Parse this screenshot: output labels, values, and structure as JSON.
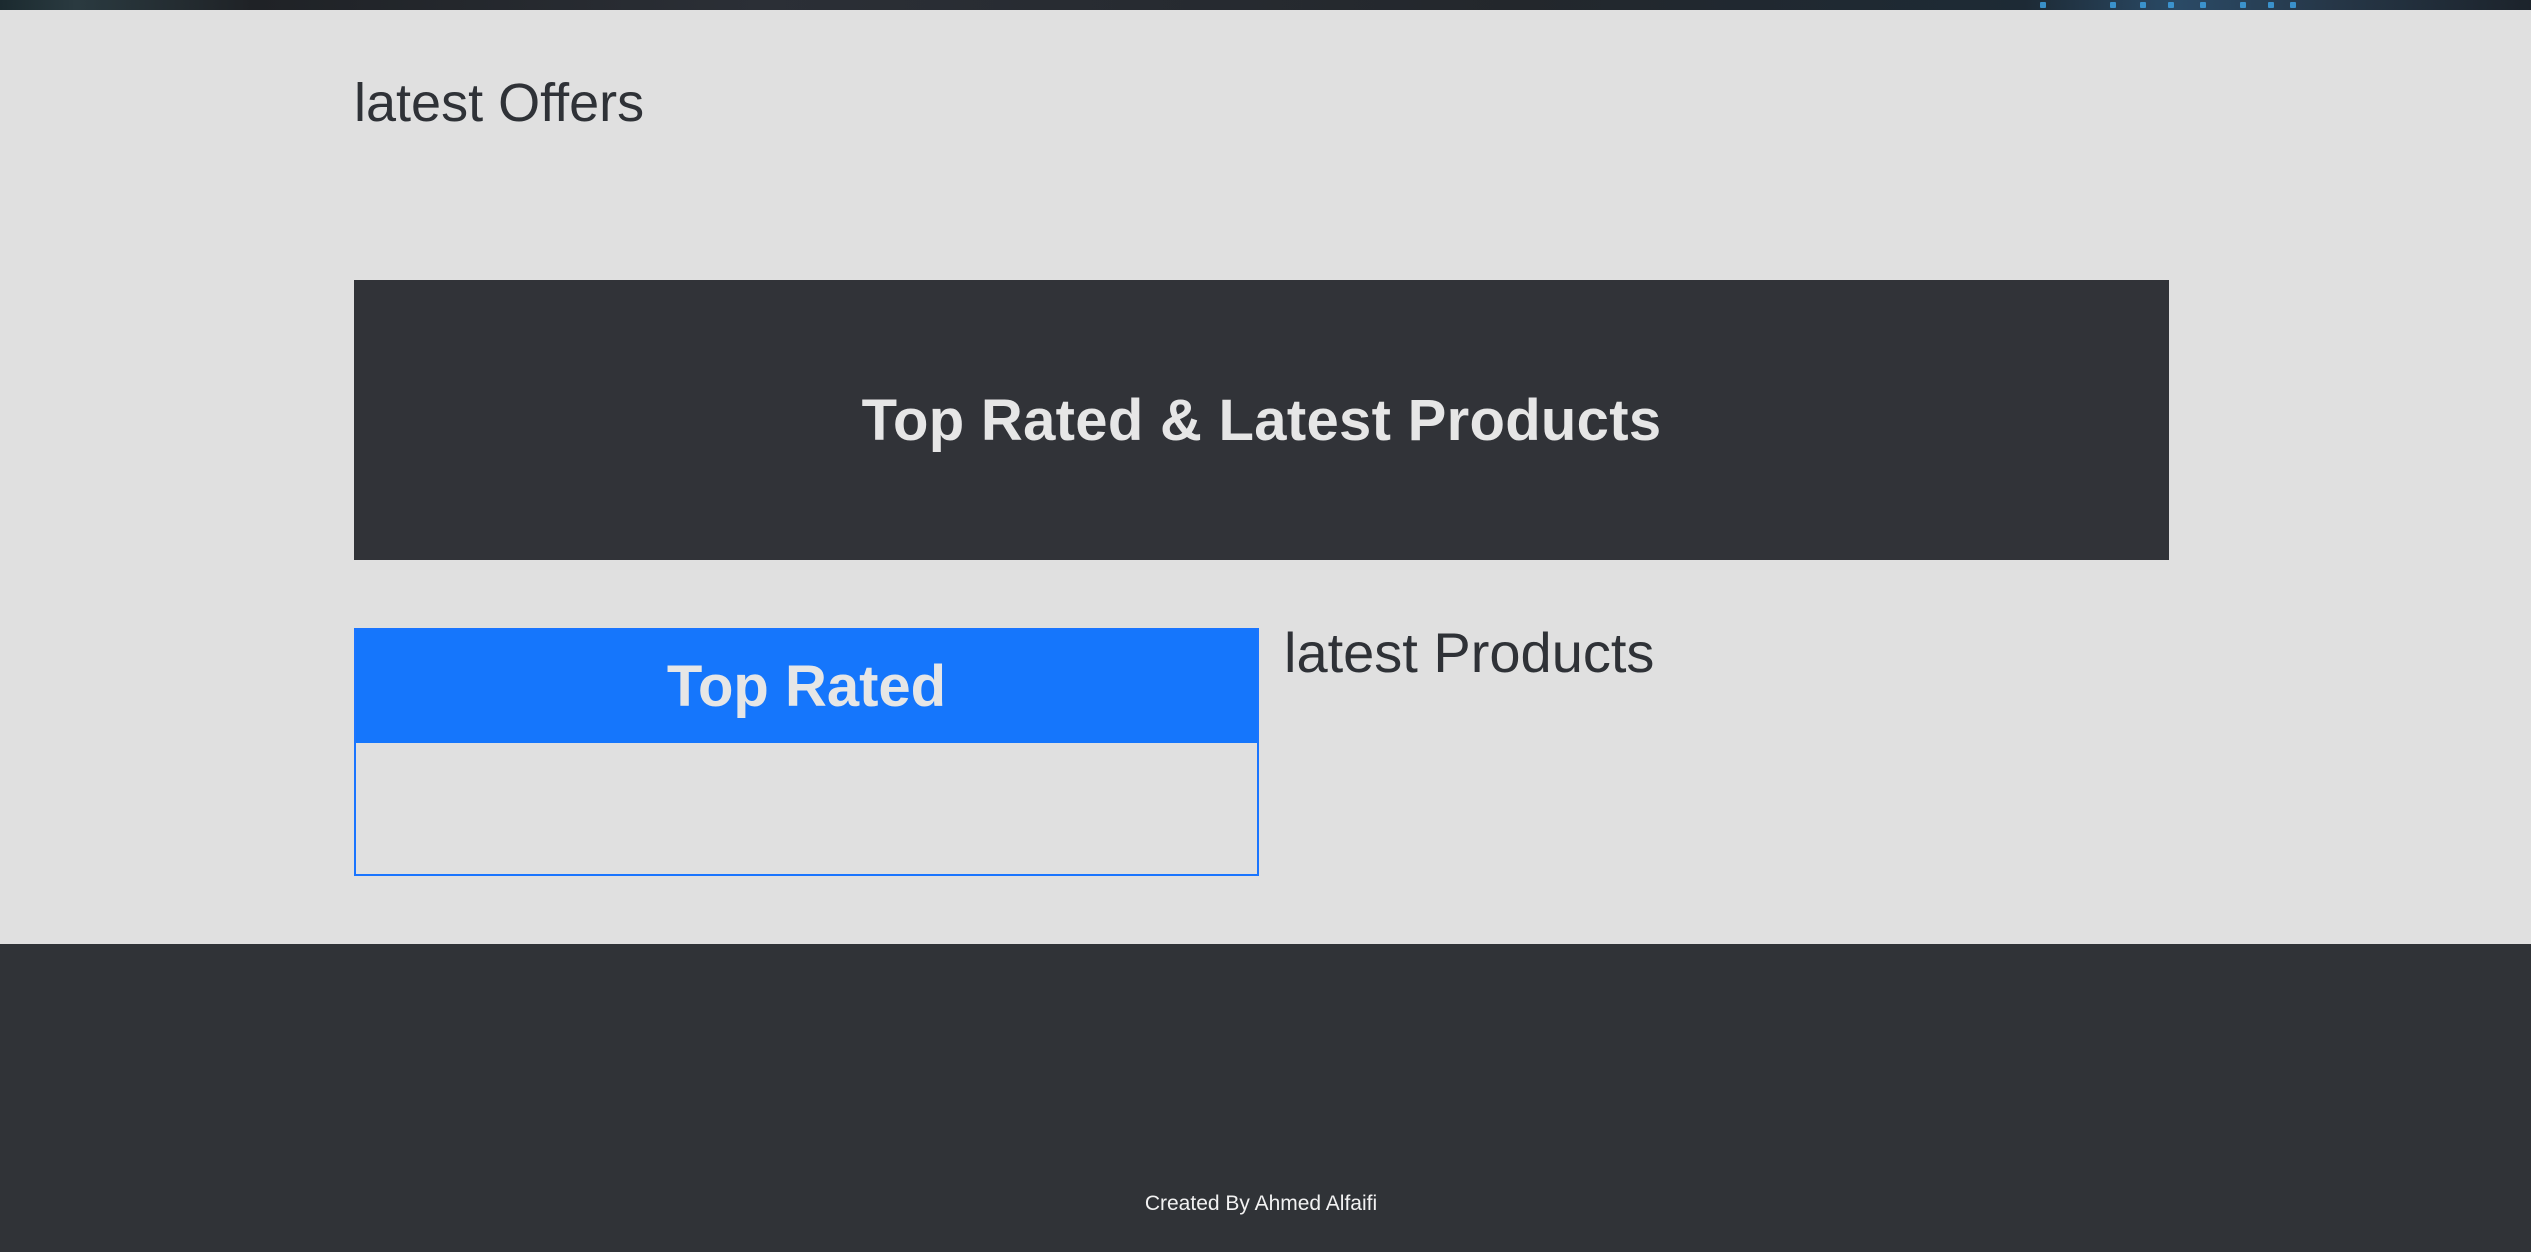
{
  "header": {
    "background_image_icon": "banner-image"
  },
  "offers": {
    "title": "latest Offers"
  },
  "banner": {
    "title": "Top Rated & Latest Products",
    "background": "#313338"
  },
  "top_rated": {
    "title": "Top Rated",
    "accent": "#1576fc"
  },
  "latest_products": {
    "title": "latest Products"
  },
  "footer": {
    "credit": "Created By Ahmed Alfaifi",
    "background": "#303337"
  }
}
